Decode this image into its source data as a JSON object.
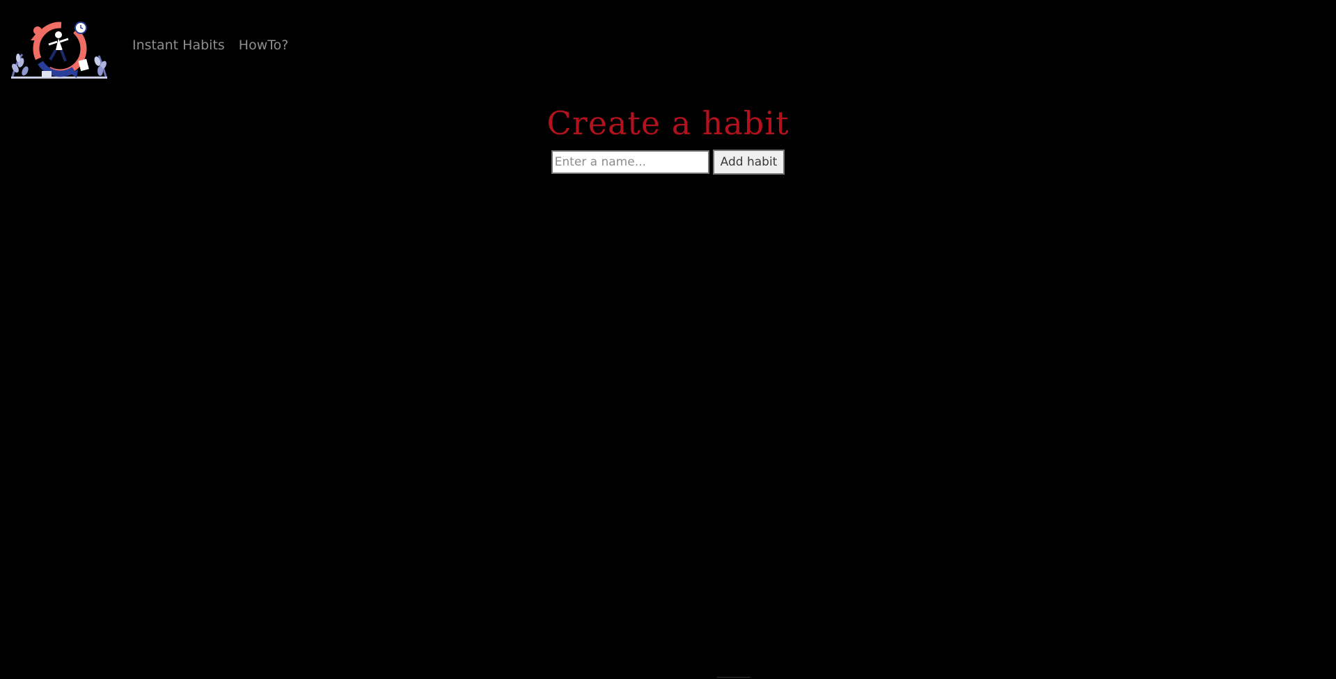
{
  "nav": {
    "items": [
      {
        "label": "Instant Habits"
      },
      {
        "label": "HowTo?"
      }
    ]
  },
  "main": {
    "title": "Create a habit",
    "name_input": {
      "value": "",
      "placeholder": "Enter a name..."
    },
    "add_button_label": "Add habit"
  },
  "colors": {
    "background": "#000000",
    "title": "#b3121d",
    "nav_text": "#8f8f8f"
  }
}
